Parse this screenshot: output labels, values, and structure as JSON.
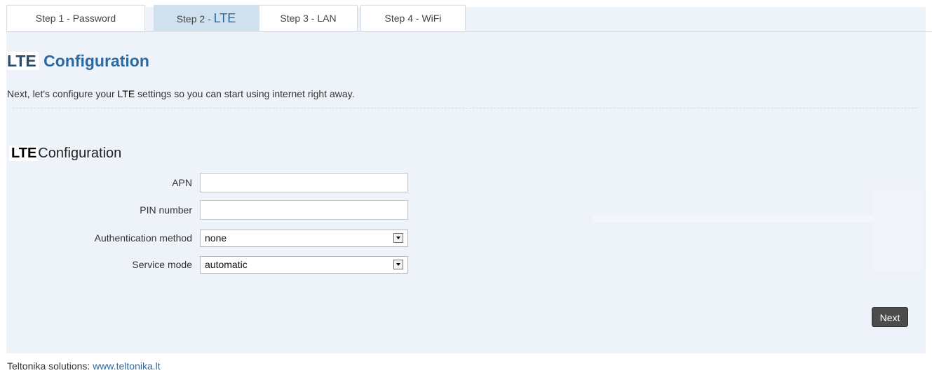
{
  "tabs": [
    {
      "prefix": "Step 1 - Password",
      "highlight": ""
    },
    {
      "prefix": "Step 2 - ",
      "highlight": "LTE"
    },
    {
      "prefix": "Step 3 - LAN",
      "highlight": ""
    },
    {
      "prefix": "Step 4 - WiFi",
      "highlight": ""
    }
  ],
  "header": {
    "badge": "LTE",
    "title": "Configuration"
  },
  "intro": {
    "before": "Next, let's configure your ",
    "emph": "LTE",
    "after": " settings so you can start using internet right away."
  },
  "section": {
    "badge": "LTE",
    "title": "Configuration"
  },
  "form": {
    "apn": {
      "label": "APN",
      "value": ""
    },
    "pin": {
      "label": "PIN number",
      "value": ""
    },
    "auth": {
      "label": "Authentication method",
      "value": "none"
    },
    "service": {
      "label": "Service mode",
      "value": "automatic"
    }
  },
  "actions": {
    "next_label": "Next"
  },
  "footer": {
    "text": "Teltonika solutions: ",
    "link": "www.teltonika.lt"
  }
}
